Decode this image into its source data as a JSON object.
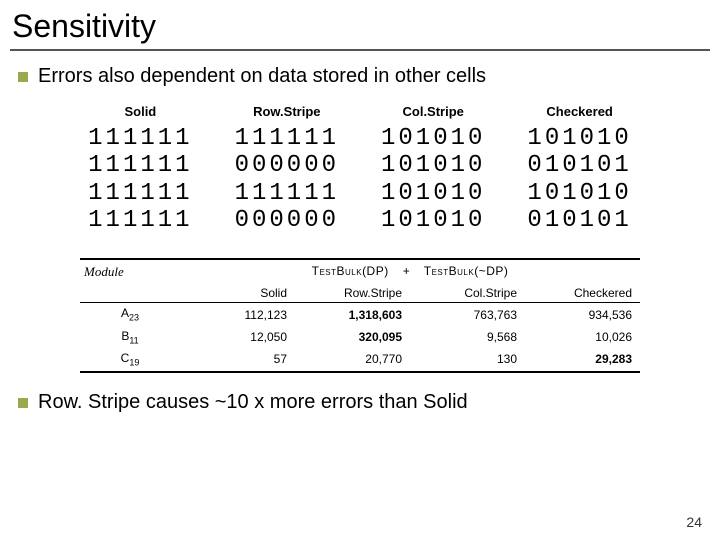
{
  "title": "Sensitivity",
  "bullet1": "Errors also dependent on data stored in other cells",
  "bullet2": "Row. Stripe causes ~10 x more errors than Solid",
  "patterns": {
    "heads": [
      "Solid",
      "Row.Stripe",
      "Col.Stripe",
      "Checkered"
    ],
    "blocks": [
      "111111\n111111\n111111\n111111",
      "111111\n000000\n111111\n000000",
      "101010\n101010\n101010\n101010",
      "101010\n010101\n101010\n010101"
    ]
  },
  "results": {
    "module_head": "Module",
    "formula_left": "TestBulk(DP)",
    "formula_right": "TestBulk(~DP)",
    "pattern_heads": [
      "Solid",
      "Row.Stripe",
      "Col.Stripe",
      "Checkered"
    ],
    "rows": [
      {
        "mod_main": "A",
        "mod_sub": "23",
        "vals": [
          "112,123",
          "1,318,603",
          "763,763",
          "934,536"
        ],
        "bold": [
          false,
          true,
          false,
          false
        ]
      },
      {
        "mod_main": "B",
        "mod_sub": "11",
        "vals": [
          "12,050",
          "320,095",
          "9,568",
          "10,026"
        ],
        "bold": [
          false,
          true,
          false,
          false
        ]
      },
      {
        "mod_main": "C",
        "mod_sub": "19",
        "vals": [
          "57",
          "20,770",
          "130",
          "29,283"
        ],
        "bold": [
          false,
          false,
          false,
          true
        ]
      }
    ]
  },
  "page": "24"
}
